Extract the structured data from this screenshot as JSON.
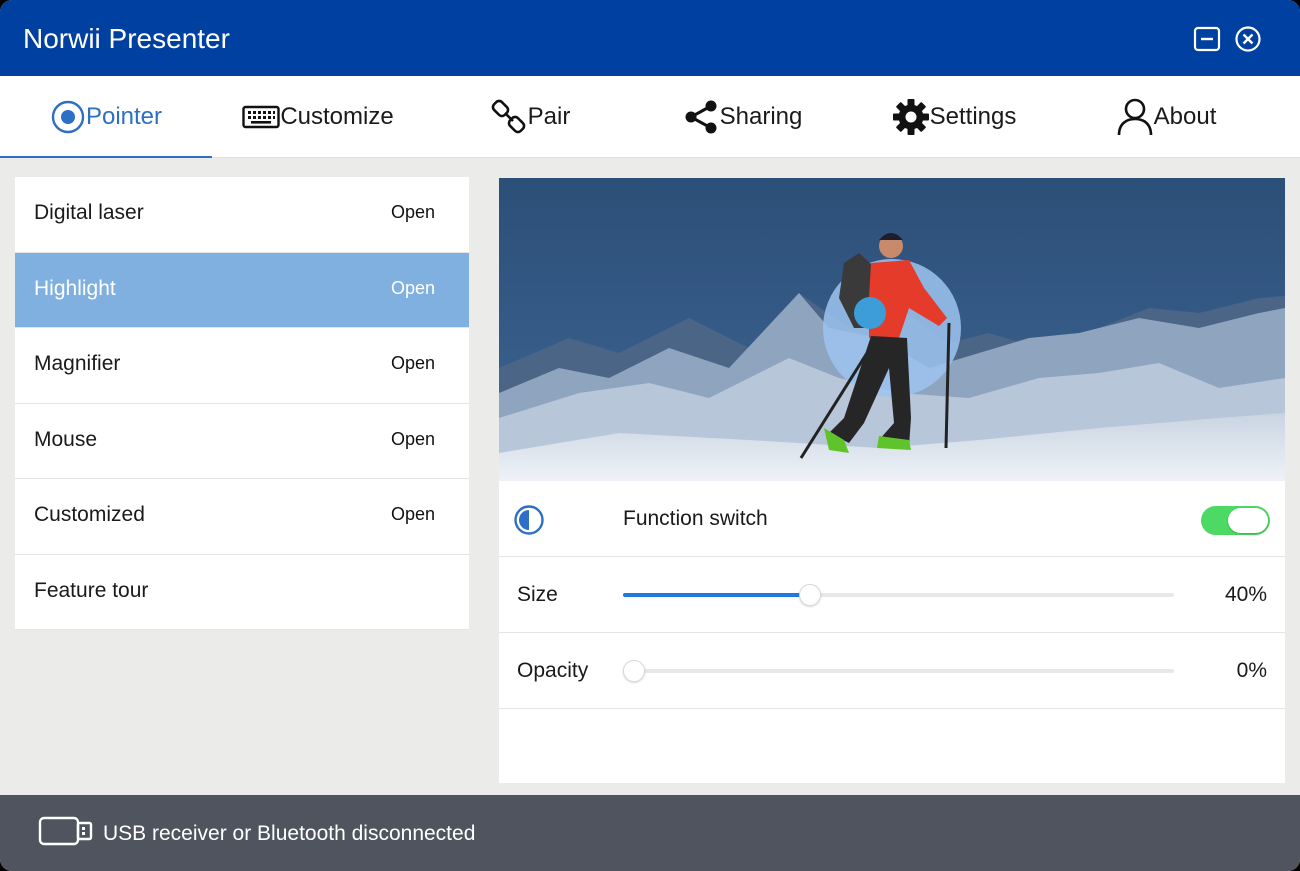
{
  "window": {
    "title": "Norwii Presenter"
  },
  "tabs": [
    {
      "label": "Pointer",
      "icon": "radio-target-icon",
      "active": true
    },
    {
      "label": "Customize",
      "icon": "keyboard-icon"
    },
    {
      "label": "Pair",
      "icon": "link-icon"
    },
    {
      "label": "Sharing",
      "icon": "share-icon"
    },
    {
      "label": "Settings",
      "icon": "gear-icon"
    },
    {
      "label": "About",
      "icon": "user-icon"
    }
  ],
  "pointer_list": [
    {
      "label": "Digital laser",
      "action": "Open"
    },
    {
      "label": "Highlight",
      "action": "Open",
      "selected": true
    },
    {
      "label": "Magnifier",
      "action": "Open"
    },
    {
      "label": "Mouse",
      "action": "Open"
    },
    {
      "label": "Customized",
      "action": "Open"
    },
    {
      "label": "Feature tour",
      "action": ""
    }
  ],
  "highlight_settings": {
    "function_switch": {
      "label": "Function switch",
      "on": true
    },
    "size": {
      "label": "Size",
      "value": "40%",
      "fraction": 0.34
    },
    "opacity": {
      "label": "Opacity",
      "value": "0%",
      "fraction": 0.0
    }
  },
  "status": {
    "text": "USB receiver or Bluetooth disconnected",
    "icon": "usb-icon"
  },
  "colors": {
    "titlebar": "#0040a0",
    "accent": "#2d6fc4",
    "selected_row": "#7fb0e0",
    "toggle_on": "#4cd964",
    "slider_fill": "#1f7ae0",
    "statusbar": "#4f545f"
  }
}
